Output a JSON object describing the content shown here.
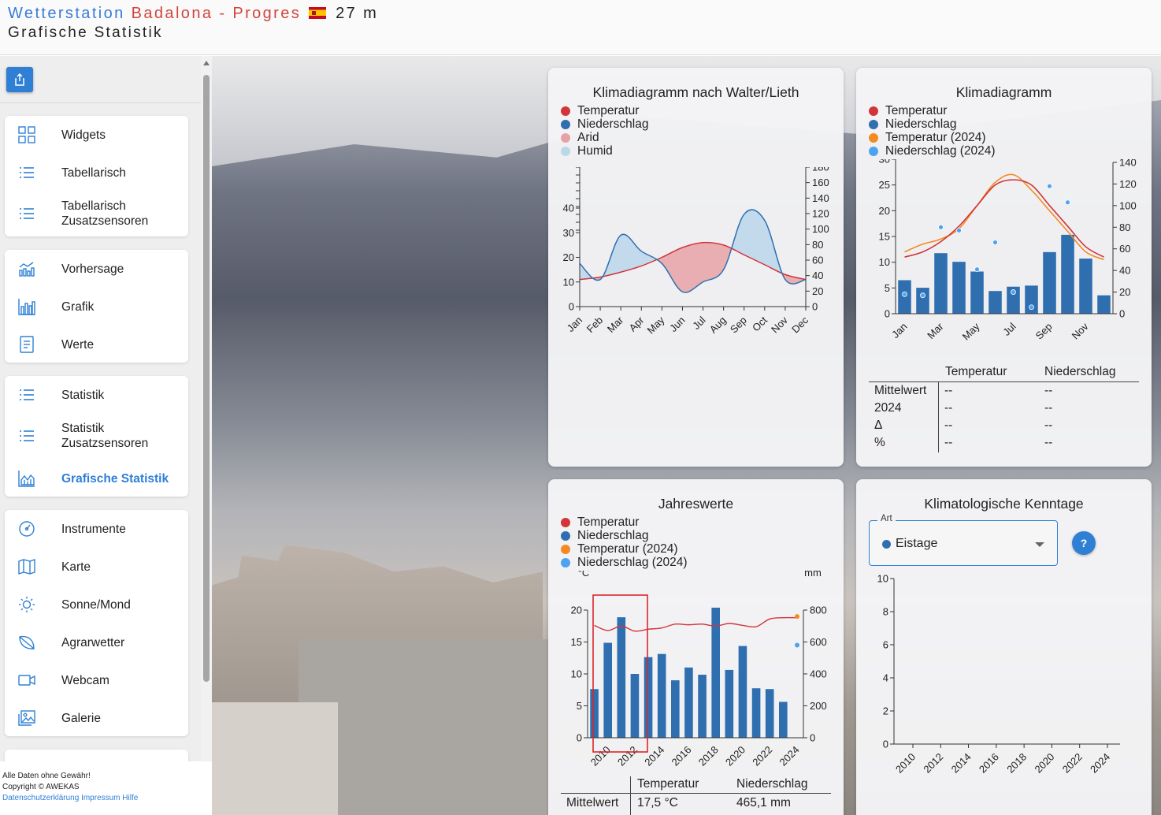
{
  "header": {
    "title_part1": "Wetterstation",
    "title_part2": "Badalona - Progres",
    "altitude": "27 m",
    "subtitle": "Grafische Statistik"
  },
  "sidebar": {
    "groups": [
      {
        "items": [
          {
            "label": "Widgets",
            "icon": "widgets-icon"
          },
          {
            "label": "Tabellarisch",
            "icon": "list-icon"
          },
          {
            "label": "Tabellarisch\nZusatzsensoren",
            "icon": "list-icon"
          }
        ]
      },
      {
        "items": [
          {
            "label": "Vorhersage",
            "icon": "forecast-chart-icon"
          },
          {
            "label": "Grafik",
            "icon": "bar-chart-icon"
          },
          {
            "label": "Werte",
            "icon": "document-icon"
          }
        ]
      },
      {
        "items": [
          {
            "label": "Statistik",
            "icon": "list-icon"
          },
          {
            "label": "Statistik\nZusatzsensoren",
            "icon": "list-icon"
          },
          {
            "label": "Grafische Statistik",
            "icon": "area-chart-icon",
            "active": true
          }
        ]
      },
      {
        "items": [
          {
            "label": "Instrumente",
            "icon": "gauge-icon"
          },
          {
            "label": "Karte",
            "icon": "map-icon"
          },
          {
            "label": "Sonne/Mond",
            "icon": "sun-icon"
          },
          {
            "label": "Agrarwetter",
            "icon": "leaf-icon"
          },
          {
            "label": "Webcam",
            "icon": "camera-icon"
          },
          {
            "label": "Galerie",
            "icon": "gallery-icon"
          }
        ]
      }
    ]
  },
  "footer": {
    "line1": "Alle Daten ohne Gewähr!",
    "line2": "Copyright © AWEKAS",
    "privacy_link": "Datenschutzerklärung",
    "imprint_link": "Impressum",
    "help_link": "Hilfe"
  },
  "colors": {
    "accent": "#2f80d4",
    "temperature": "#d1353a",
    "precipitation": "#2f6fb0",
    "temperature_2024": "#f58a23",
    "precipitation_2024": "#4da3f0",
    "arid": "#e7a2a6",
    "humid": "#bcd7ea"
  },
  "walter_lieth": {
    "title": "Klimadiagramm nach Walter/Lieth",
    "legend": [
      "Temperatur",
      "Niederschlag",
      "Arid",
      "Humid"
    ]
  },
  "klimadiagramm": {
    "title": "Klimadiagramm",
    "legend": [
      "Temperatur",
      "Niederschlag",
      "Temperatur (2024)",
      "Niederschlag (2024)"
    ],
    "table": {
      "headers": [
        "Temperatur",
        "Niederschlag"
      ],
      "rows": [
        {
          "label": "Mittelwert",
          "temp": "--",
          "precip": "--"
        },
        {
          "label": "2024",
          "temp": "--",
          "precip": "--"
        },
        {
          "label": "Δ",
          "temp": "--",
          "precip": "--"
        },
        {
          "label": "%",
          "temp": "--",
          "precip": "--"
        }
      ]
    }
  },
  "jahreswerte": {
    "title": "Jahreswerte",
    "legend": [
      "Temperatur",
      "Niederschlag",
      "Temperatur (2024)",
      "Niederschlag (2024)"
    ],
    "table": {
      "headers": [
        "Temperatur",
        "Niederschlag"
      ],
      "row_label": "Mittelwert",
      "temp": "17,5 °C",
      "precip": "465,1 mm"
    }
  },
  "kenntage": {
    "title": "Klimatologische Kenntage",
    "select_label": "Art",
    "select_value": "Eistage",
    "help": "?"
  },
  "chart_data": [
    {
      "type": "line",
      "title": "Klimadiagramm nach Walter/Lieth",
      "categories": [
        "Jan",
        "Feb",
        "Mar",
        "Apr",
        "May",
        "Jun",
        "Jul",
        "Aug",
        "Sep",
        "Oct",
        "Nov",
        "Dec"
      ],
      "series": [
        {
          "name": "Temperatur",
          "axis": "left",
          "values": [
            11,
            12,
            14,
            16.5,
            20,
            24,
            26,
            25,
            21,
            17,
            13,
            11
          ]
        },
        {
          "name": "Niederschlag",
          "axis": "right",
          "values": [
            35,
            22,
            58,
            45,
            35,
            12,
            20,
            30,
            75,
            70,
            22,
            22
          ]
        }
      ],
      "ylim_left": [
        0,
        40
      ],
      "yticks_left": [
        0,
        10,
        20,
        30,
        40
      ],
      "ylim_right": [
        0,
        180
      ],
      "yticks_right": [
        0,
        20,
        40,
        60,
        80,
        100,
        120,
        140,
        160,
        180
      ],
      "fill": {
        "arid": "Temperatur above Niederschlag",
        "humid": "Niederschlag above Temperatur"
      }
    },
    {
      "type": "bar",
      "title": "Klimadiagramm",
      "categories": [
        "Jan",
        "Feb",
        "Mar",
        "Apr",
        "May",
        "Jun",
        "Jul",
        "Aug",
        "Sep",
        "Oct",
        "Nov",
        "Dec"
      ],
      "xtick_labels": [
        "Jan",
        "Mar",
        "May",
        "Jul",
        "Sep",
        "Nov"
      ],
      "series": [
        {
          "name": "Niederschlag",
          "axis": "right",
          "kind": "bar",
          "values": [
            31,
            24,
            56,
            48,
            39,
            21,
            25,
            26,
            57,
            73,
            51,
            17
          ]
        },
        {
          "name": "Temperatur",
          "axis": "left",
          "kind": "line",
          "values": [
            11,
            12,
            14,
            17,
            21,
            25,
            26,
            25,
            21,
            17,
            13,
            11
          ]
        },
        {
          "name": "Temperatur (2024)",
          "axis": "left",
          "kind": "line",
          "values": [
            12,
            13.5,
            14.5,
            16.5,
            21,
            25.5,
            27,
            24,
            20,
            16,
            12,
            10.5
          ]
        },
        {
          "name": "Niederschlag (2024)",
          "axis": "right",
          "kind": "points",
          "values": [
            18,
            17,
            80,
            77,
            41,
            66,
            20,
            6,
            118,
            103,
            null,
            null
          ]
        }
      ],
      "ylabel_left": "°C",
      "ylim_left": [
        0,
        30
      ],
      "yticks_left": [
        0,
        5,
        10,
        15,
        20,
        25,
        30
      ],
      "ylabel_right": "mm",
      "ylim_right": [
        0,
        140
      ],
      "yticks_right": [
        0,
        20,
        40,
        60,
        80,
        100,
        120,
        140
      ]
    },
    {
      "type": "bar",
      "title": "Jahreswerte",
      "categories": [
        "2009",
        "2010",
        "2011",
        "2012",
        "2013",
        "2014",
        "2015",
        "2016",
        "2017",
        "2018",
        "2019",
        "2020",
        "2021",
        "2022",
        "2023",
        "2024"
      ],
      "xtick_labels": [
        "2010",
        "2012",
        "2014",
        "2016",
        "2018",
        "2020",
        "2022",
        "2024"
      ],
      "series": [
        {
          "name": "Niederschlag",
          "axis": "right",
          "kind": "bar",
          "values": [
            305,
            595,
            755,
            400,
            505,
            525,
            360,
            440,
            395,
            815,
            425,
            575,
            310,
            305,
            225,
            null
          ]
        },
        {
          "name": "Temperatur",
          "axis": "left",
          "kind": "line",
          "values": [
            17.6,
            16.8,
            17.5,
            16.7,
            17.0,
            17.2,
            17.8,
            17.7,
            17.8,
            17.5,
            17.9,
            17.6,
            17.4,
            18.6,
            18.8,
            18.8
          ]
        },
        {
          "name": "Temperatur (2024)",
          "axis": "left",
          "kind": "points",
          "values": [
            null,
            null,
            null,
            null,
            null,
            null,
            null,
            null,
            null,
            null,
            null,
            null,
            null,
            null,
            null,
            19
          ]
        },
        {
          "name": "Niederschlag (2024)",
          "axis": "right",
          "kind": "points",
          "values": [
            null,
            null,
            null,
            null,
            null,
            null,
            null,
            null,
            null,
            null,
            null,
            null,
            null,
            null,
            null,
            580
          ]
        }
      ],
      "ylabel_left": "°C",
      "ylim_left": [
        0,
        20
      ],
      "yticks_left": [
        0,
        5,
        10,
        15,
        20
      ],
      "ylabel_right": "mm",
      "ylim_right": [
        0,
        800
      ],
      "yticks_right": [
        0,
        200,
        400,
        600,
        800
      ]
    },
    {
      "type": "bar",
      "title": "Klimatologische Kenntage",
      "categories": [
        "2010",
        "2012",
        "2014",
        "2016",
        "2018",
        "2020",
        "2022",
        "2024"
      ],
      "series": [
        {
          "name": "Eistage",
          "values": [
            0,
            0,
            0,
            0,
            0,
            0,
            0,
            0
          ]
        }
      ],
      "ylim": [
        0,
        10
      ],
      "yticks": [
        0,
        2,
        4,
        6,
        8,
        10
      ]
    }
  ]
}
